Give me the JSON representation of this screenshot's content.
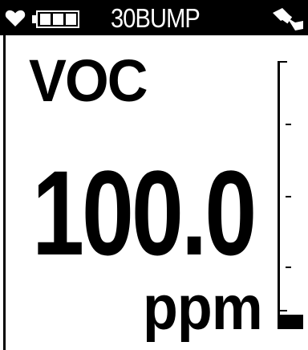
{
  "status_bar": {
    "text": "30BUMP",
    "heart_icon": "heart-icon",
    "battery_icon": "battery-icon",
    "battery_level": 1.0,
    "sensor_icon": "bump-sensor-icon"
  },
  "main": {
    "gas_name": "VOC",
    "reading": "100.0",
    "unit": "ppm"
  },
  "bar_graph": {
    "level": 0.02
  },
  "colors": {
    "foreground": "#000000",
    "background": "#ffffff"
  }
}
